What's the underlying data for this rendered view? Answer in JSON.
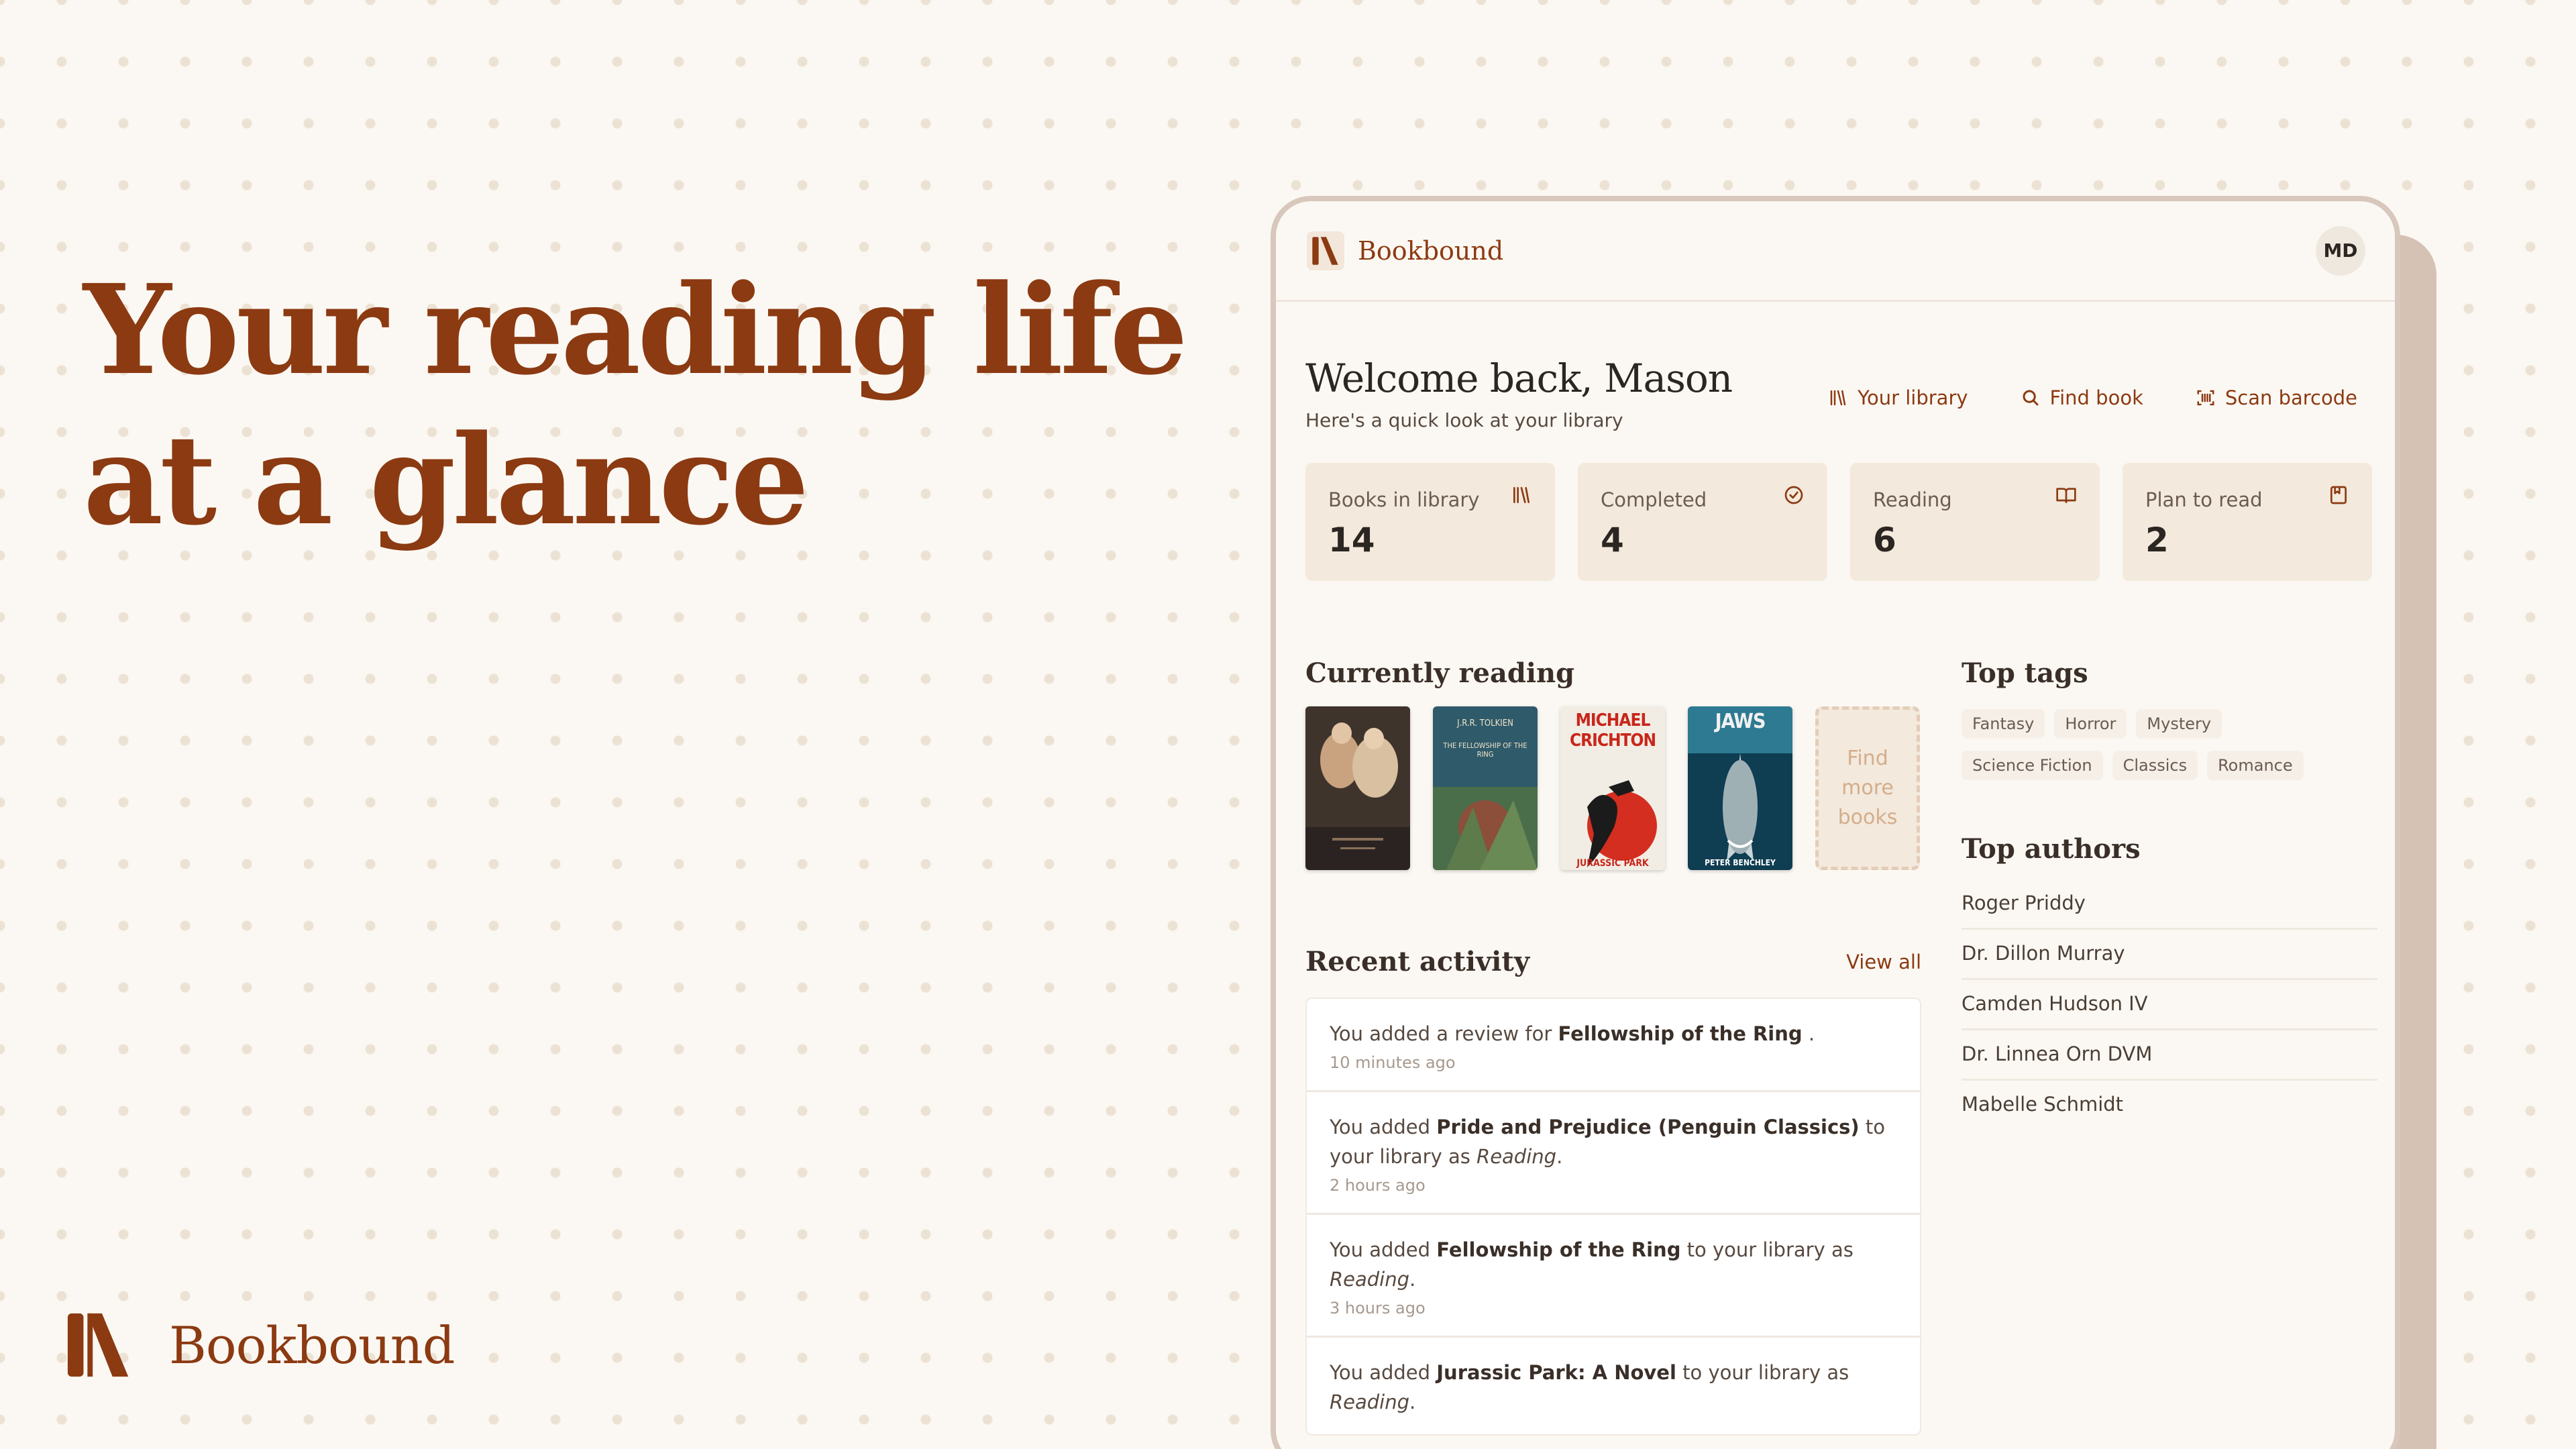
{
  "hero": {
    "line1": "Your reading life",
    "line2": "at a glance"
  },
  "brand": {
    "name": "Bookbound",
    "color": "#8c3a12"
  },
  "app": {
    "brand_name": "Bookbound",
    "avatar_initials": "MD",
    "welcome_title": "Welcome back, Mason",
    "welcome_subtitle": "Here's a quick look at your library",
    "actions": [
      {
        "label": "Your library",
        "icon": "library-icon"
      },
      {
        "label": "Find book",
        "icon": "search-icon"
      },
      {
        "label": "Scan barcode",
        "icon": "barcode-scan-icon"
      }
    ],
    "stats": [
      {
        "label": "Books in library",
        "value": "14",
        "icon": "library-icon"
      },
      {
        "label": "Completed",
        "value": "4",
        "icon": "check-circle-icon"
      },
      {
        "label": "Reading",
        "value": "6",
        "icon": "open-book-icon"
      },
      {
        "label": "Plan to read",
        "value": "2",
        "icon": "bookmark-book-icon"
      }
    ],
    "currently_reading": {
      "title": "Currently reading",
      "books": [
        {
          "cover_title": "",
          "cover_author": ""
        },
        {
          "cover_title": "THE FELLOWSHIP OF THE RING",
          "cover_author": "J.R.R. TOLKIEN"
        },
        {
          "cover_title": "JURASSIC PARK",
          "cover_author": "MICHAEL CRICHTON"
        },
        {
          "cover_title": "JAWS",
          "cover_author": "PETER BENCHLEY"
        }
      ],
      "find_more": "Find more books"
    },
    "recent_activity": {
      "title": "Recent activity",
      "view_all": "View all",
      "items": [
        {
          "pre": "You added a review for ",
          "book": "Fellowship of the Ring",
          "post": " .",
          "status": "",
          "time": "10 minutes ago"
        },
        {
          "pre": "You added ",
          "book": "Pride and Prejudice (Penguin Classics)",
          "post": " to your library as ",
          "status": "Reading",
          "time": "2 hours ago"
        },
        {
          "pre": "You added ",
          "book": "Fellowship of the Ring",
          "post": " to your library as ",
          "status": "Reading",
          "time": "3 hours ago"
        },
        {
          "pre": "You added ",
          "book": "Jurassic Park: A Novel",
          "post": " to your library as ",
          "status": "Reading",
          "time": ""
        }
      ]
    },
    "top_tags": {
      "title": "Top tags",
      "tags": [
        "Fantasy",
        "Horror",
        "Mystery",
        "Science Fiction",
        "Classics",
        "Romance"
      ]
    },
    "top_authors": {
      "title": "Top authors",
      "authors": [
        "Roger Priddy",
        "Dr. Dillon Murray",
        "Camden Hudson IV",
        "Dr. Linnea Orn DVM",
        "Mabelle Schmidt"
      ]
    }
  }
}
